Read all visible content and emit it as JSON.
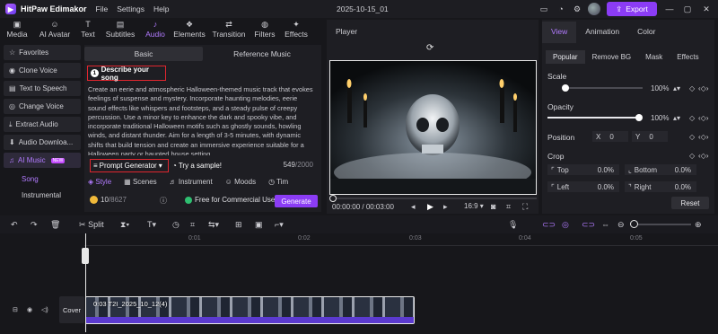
{
  "app": {
    "title": "HitPaw Edimakor",
    "menus": [
      "File",
      "Settings",
      "Help"
    ],
    "project_name": "2025-10-15_01",
    "export_label": "Export"
  },
  "toolbar_tabs": [
    {
      "label": "Media",
      "icon": "media-icon"
    },
    {
      "label": "AI Avatar",
      "icon": "avatar-icon"
    },
    {
      "label": "Text",
      "icon": "text-icon"
    },
    {
      "label": "Subtitles",
      "icon": "subtitles-icon"
    },
    {
      "label": "Audio",
      "icon": "audio-icon",
      "active": true
    },
    {
      "label": "Elements",
      "icon": "elements-icon"
    },
    {
      "label": "Transition",
      "icon": "transition-icon"
    },
    {
      "label": "Filters",
      "icon": "filters-icon"
    },
    {
      "label": "Effects",
      "icon": "effects-icon"
    }
  ],
  "sidebar": {
    "items": [
      "Favorites",
      "Clone Voice",
      "Text to Speech",
      "Change Voice",
      "Extract Audio",
      "Audio Downloa...",
      "AI Music"
    ],
    "new_badge": "NEW",
    "subitems": [
      "Song",
      "Instrumental"
    ]
  },
  "music_panel": {
    "tabs": [
      "Basic",
      "Reference Music"
    ],
    "step_number": "1",
    "describe_label": "Describe your song",
    "prompt_text": "Create an eerie and atmospheric Halloween-themed music track that evokes feelings of suspense and mystery. Incorporate haunting melodies, eerie sound effects like whispers and footsteps, and a steady pulse of creepy percussion. Use a minor key to enhance the dark and spooky vibe, and incorporate traditional Halloween motifs such as ghostly sounds, howling winds, and distant thunder. Aim for a length of 3-5 minutes, with dynamic shifts that build tension and create an immersive experience suitable for a Halloween party or haunted house setting.",
    "prompt_generator_label": "Prompt Generator",
    "try_sample_label": "Try a sample!",
    "char_count": "549",
    "char_limit": "/2000",
    "style_tabs": [
      "Style",
      "Scenes",
      "Instrument",
      "Moods",
      "Tim"
    ],
    "credits": "10",
    "credits_total": "/8627",
    "free_label": "Free for Commercial Use",
    "generate_label": "Generate"
  },
  "player": {
    "label": "Player",
    "time_current": "00:00:00",
    "time_total": "00:03:00",
    "aspect": "16:9"
  },
  "props": {
    "tabs": [
      "View",
      "Animation",
      "Color"
    ],
    "subtabs": [
      "Popular",
      "Remove BG",
      "Mask",
      "Effects"
    ],
    "scale_label": "Scale",
    "scale_value": "100%",
    "scale_level": 1.0,
    "opacity_label": "Opacity",
    "opacity_value": "100%",
    "opacity_level": 1.0,
    "position_label": "Position",
    "pos_x_label": "X",
    "pos_x": "0",
    "pos_y_label": "Y",
    "pos_y": "0",
    "crop_label": "Crop",
    "crop_top_label": "Top",
    "crop_top": "0.0%",
    "crop_bottom_label": "Bottom",
    "crop_bottom": "0.0%",
    "crop_left_label": "Left",
    "crop_left": "0.0%",
    "crop_right_label": "Right",
    "crop_right": "0.0%",
    "reset_label": "Reset"
  },
  "timeline": {
    "split_label": "Split",
    "ruler": [
      "0:01",
      "0:02",
      "0:03",
      "0:04",
      "0:05"
    ],
    "cover_label": "Cover",
    "clip_label": "0:03  T2I_2025_10_12(4)"
  },
  "colors": {
    "accent": "#8b3cf5",
    "highlight": "#e0262f",
    "active_text": "#b27bff"
  }
}
